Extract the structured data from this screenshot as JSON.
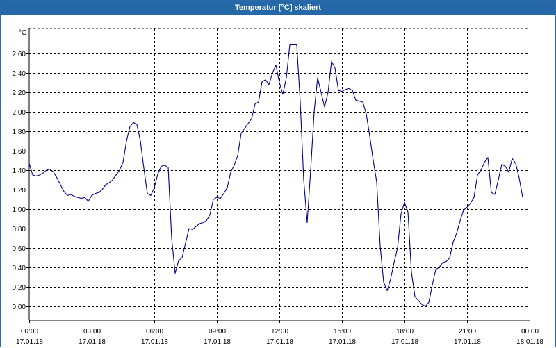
{
  "window": {
    "title": "Temperatur [°C] skaliert"
  },
  "colors": {
    "titlebar": "#2568a8",
    "line": "#00008b",
    "grid": "#000000"
  },
  "chart_data": {
    "type": "line",
    "title": "Temperatur [°C] skaliert",
    "ylabel": "°C",
    "xlabel": "",
    "ylim": [
      -0.1,
      2.8
    ],
    "xlim": [
      0,
      1440
    ],
    "grid": true,
    "y_ticks": [
      "0,00",
      "0,20",
      "0,40",
      "0,60",
      "0,80",
      "1,00",
      "1,20",
      "1,40",
      "1,60",
      "1,80",
      "2,00",
      "2,20",
      "2,40",
      "2,60"
    ],
    "x_ticks": [
      {
        "time": "00:00",
        "date": "17.01.18"
      },
      {
        "time": "03:00",
        "date": "17.01.18"
      },
      {
        "time": "06:00",
        "date": "17.01.18"
      },
      {
        "time": "09:00",
        "date": "17.01.18"
      },
      {
        "time": "12:00",
        "date": "17.01.18"
      },
      {
        "time": "15:00",
        "date": "17.01.18"
      },
      {
        "time": "18:00",
        "date": "17.01.18"
      },
      {
        "time": "21:00",
        "date": "17.01.18"
      },
      {
        "time": "00:00",
        "date": "18.01.18"
      }
    ],
    "series": [
      {
        "x_unit": "minutes since 00:00 17.01.18",
        "points": [
          [
            0,
            1.47
          ],
          [
            10,
            1.35
          ],
          [
            20,
            1.34
          ],
          [
            30,
            1.35
          ],
          [
            40,
            1.37
          ],
          [
            50,
            1.4
          ],
          [
            60,
            1.41
          ],
          [
            70,
            1.38
          ],
          [
            80,
            1.32
          ],
          [
            90,
            1.25
          ],
          [
            100,
            1.18
          ],
          [
            110,
            1.14
          ],
          [
            120,
            1.15
          ],
          [
            130,
            1.13
          ],
          [
            140,
            1.12
          ],
          [
            150,
            1.11
          ],
          [
            160,
            1.12
          ],
          [
            170,
            1.08
          ],
          [
            180,
            1.14
          ],
          [
            190,
            1.16
          ],
          [
            200,
            1.17
          ],
          [
            210,
            1.2
          ],
          [
            220,
            1.25
          ],
          [
            230,
            1.27
          ],
          [
            240,
            1.3
          ],
          [
            250,
            1.35
          ],
          [
            260,
            1.4
          ],
          [
            270,
            1.48
          ],
          [
            280,
            1.7
          ],
          [
            290,
            1.85
          ],
          [
            300,
            1.89
          ],
          [
            310,
            1.87
          ],
          [
            320,
            1.7
          ],
          [
            330,
            1.42
          ],
          [
            340,
            1.16
          ],
          [
            350,
            1.14
          ],
          [
            360,
            1.22
          ],
          [
            370,
            1.36
          ],
          [
            380,
            1.44
          ],
          [
            390,
            1.45
          ],
          [
            400,
            1.43
          ],
          [
            410,
            0.7
          ],
          [
            420,
            0.34
          ],
          [
            430,
            0.47
          ],
          [
            440,
            0.5
          ],
          [
            450,
            0.65
          ],
          [
            460,
            0.8
          ],
          [
            470,
            0.79
          ],
          [
            480,
            0.82
          ],
          [
            490,
            0.85
          ],
          [
            500,
            0.86
          ],
          [
            510,
            0.88
          ],
          [
            520,
            0.94
          ],
          [
            530,
            1.1
          ],
          [
            540,
            1.12
          ],
          [
            550,
            1.11
          ],
          [
            560,
            1.16
          ],
          [
            570,
            1.22
          ],
          [
            580,
            1.38
          ],
          [
            590,
            1.45
          ],
          [
            600,
            1.55
          ],
          [
            610,
            1.78
          ],
          [
            620,
            1.83
          ],
          [
            630,
            1.88
          ],
          [
            640,
            1.93
          ],
          [
            650,
            2.08
          ],
          [
            660,
            2.1
          ],
          [
            670,
            2.31
          ],
          [
            680,
            2.33
          ],
          [
            690,
            2.28
          ],
          [
            700,
            2.4
          ],
          [
            710,
            2.48
          ],
          [
            720,
            2.3
          ],
          [
            730,
            2.18
          ],
          [
            740,
            2.35
          ],
          [
            750,
            2.69
          ],
          [
            760,
            2.69
          ],
          [
            770,
            2.69
          ],
          [
            780,
            2.1
          ],
          [
            790,
            1.3
          ],
          [
            800,
            0.86
          ],
          [
            810,
            1.4
          ],
          [
            820,
            2.0
          ],
          [
            830,
            2.35
          ],
          [
            840,
            2.2
          ],
          [
            850,
            2.05
          ],
          [
            860,
            2.2
          ],
          [
            870,
            2.52
          ],
          [
            880,
            2.45
          ],
          [
            890,
            2.22
          ],
          [
            900,
            2.21
          ],
          [
            910,
            2.23
          ],
          [
            920,
            2.24
          ],
          [
            930,
            2.22
          ],
          [
            940,
            2.12
          ],
          [
            950,
            2.11
          ],
          [
            960,
            2.1
          ],
          [
            970,
            1.98
          ],
          [
            980,
            1.75
          ],
          [
            990,
            1.5
          ],
          [
            1000,
            1.28
          ],
          [
            1010,
            0.62
          ],
          [
            1020,
            0.25
          ],
          [
            1030,
            0.16
          ],
          [
            1040,
            0.28
          ],
          [
            1050,
            0.45
          ],
          [
            1060,
            0.6
          ],
          [
            1070,
            0.95
          ],
          [
            1080,
            1.07
          ],
          [
            1090,
            0.97
          ],
          [
            1100,
            0.35
          ],
          [
            1110,
            0.1
          ],
          [
            1120,
            0.06
          ],
          [
            1130,
            0.02
          ],
          [
            1140,
            0.0
          ],
          [
            1150,
            0.04
          ],
          [
            1160,
            0.22
          ],
          [
            1170,
            0.38
          ],
          [
            1180,
            0.4
          ],
          [
            1190,
            0.45
          ],
          [
            1200,
            0.46
          ],
          [
            1210,
            0.5
          ],
          [
            1220,
            0.66
          ],
          [
            1230,
            0.75
          ],
          [
            1240,
            0.88
          ],
          [
            1250,
            0.99
          ],
          [
            1260,
            1.02
          ],
          [
            1270,
            1.06
          ],
          [
            1280,
            1.12
          ],
          [
            1290,
            1.35
          ],
          [
            1300,
            1.4
          ],
          [
            1310,
            1.48
          ],
          [
            1320,
            1.53
          ],
          [
            1330,
            1.17
          ],
          [
            1340,
            1.15
          ],
          [
            1350,
            1.3
          ],
          [
            1360,
            1.46
          ],
          [
            1370,
            1.44
          ],
          [
            1380,
            1.38
          ],
          [
            1390,
            1.52
          ],
          [
            1400,
            1.47
          ],
          [
            1410,
            1.32
          ],
          [
            1420,
            1.12
          ]
        ]
      }
    ]
  }
}
